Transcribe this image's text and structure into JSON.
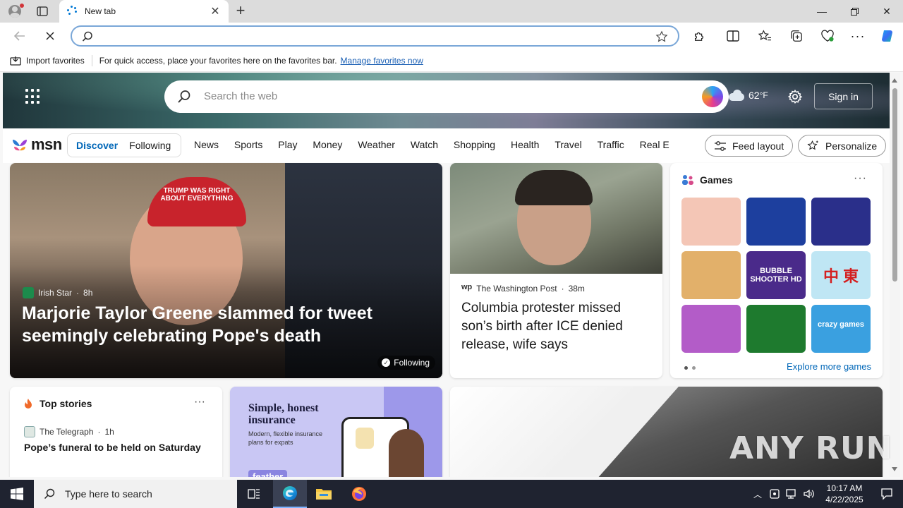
{
  "browser": {
    "tab_title": "New tab",
    "favorites_bar": {
      "import_label": "Import favorites",
      "message": "For quick access, place your favorites here on the favorites bar.",
      "manage_link": "Manage favorites now"
    }
  },
  "msn": {
    "search_placeholder": "Search the web",
    "weather": {
      "temp": "62",
      "unit": "°F"
    },
    "sign_in": "Sign in",
    "logo_text": "msn",
    "feed_tabs": [
      "Discover",
      "Following"
    ],
    "categories": [
      "News",
      "Sports",
      "Play",
      "Money",
      "Weather",
      "Watch",
      "Shopping",
      "Health",
      "Travel",
      "Traffic",
      "Real E"
    ],
    "feed_layout_label": "Feed layout",
    "personalize_label": "Personalize",
    "main_story": {
      "source": "Irish Star",
      "age": "8h",
      "headline": "Marjorie Taylor Greene slammed for tweet seemingly celebrating Pope's death",
      "badge": "Following",
      "hat_text": "TRUMP WAS RIGHT ABOUT EVERYTHING"
    },
    "story2": {
      "source_logo": "wp",
      "source": "The Washington Post",
      "age": "38m",
      "headline": "Columbia protester missed son’s birth after ICE denied release, wife says"
    },
    "games": {
      "title": "Games",
      "more_link": "Explore more games",
      "tiles": [
        {
          "label": "",
          "color": "#f4c6b6"
        },
        {
          "label": "",
          "color": "#1d3f9e"
        },
        {
          "label": "",
          "color": "#2a2f8a"
        },
        {
          "label": "",
          "color": "#e2b06a"
        },
        {
          "label": "BUBBLE SHOOTER HD",
          "color": "#4a2a8a"
        },
        {
          "label": "中 東",
          "color": "#bfe6f4"
        },
        {
          "label": "",
          "color": "#b35cc8"
        },
        {
          "label": "",
          "color": "#1e7a2e"
        },
        {
          "label": "crazy games",
          "color": "#3aa0e0"
        }
      ]
    },
    "top_stories": {
      "title": "Top stories",
      "source": "The Telegraph",
      "age": "1h",
      "headline": "Pope’s funeral to be held on Saturday"
    },
    "ad": {
      "title": "Simple, honest insurance",
      "subtitle": "Modern, flexible insurance plans for expats",
      "brand": "feather"
    }
  },
  "watermark": "ANY RUN",
  "taskbar": {
    "search_placeholder": "Type here to search",
    "time": "10:17 AM",
    "date": "4/22/2025"
  }
}
